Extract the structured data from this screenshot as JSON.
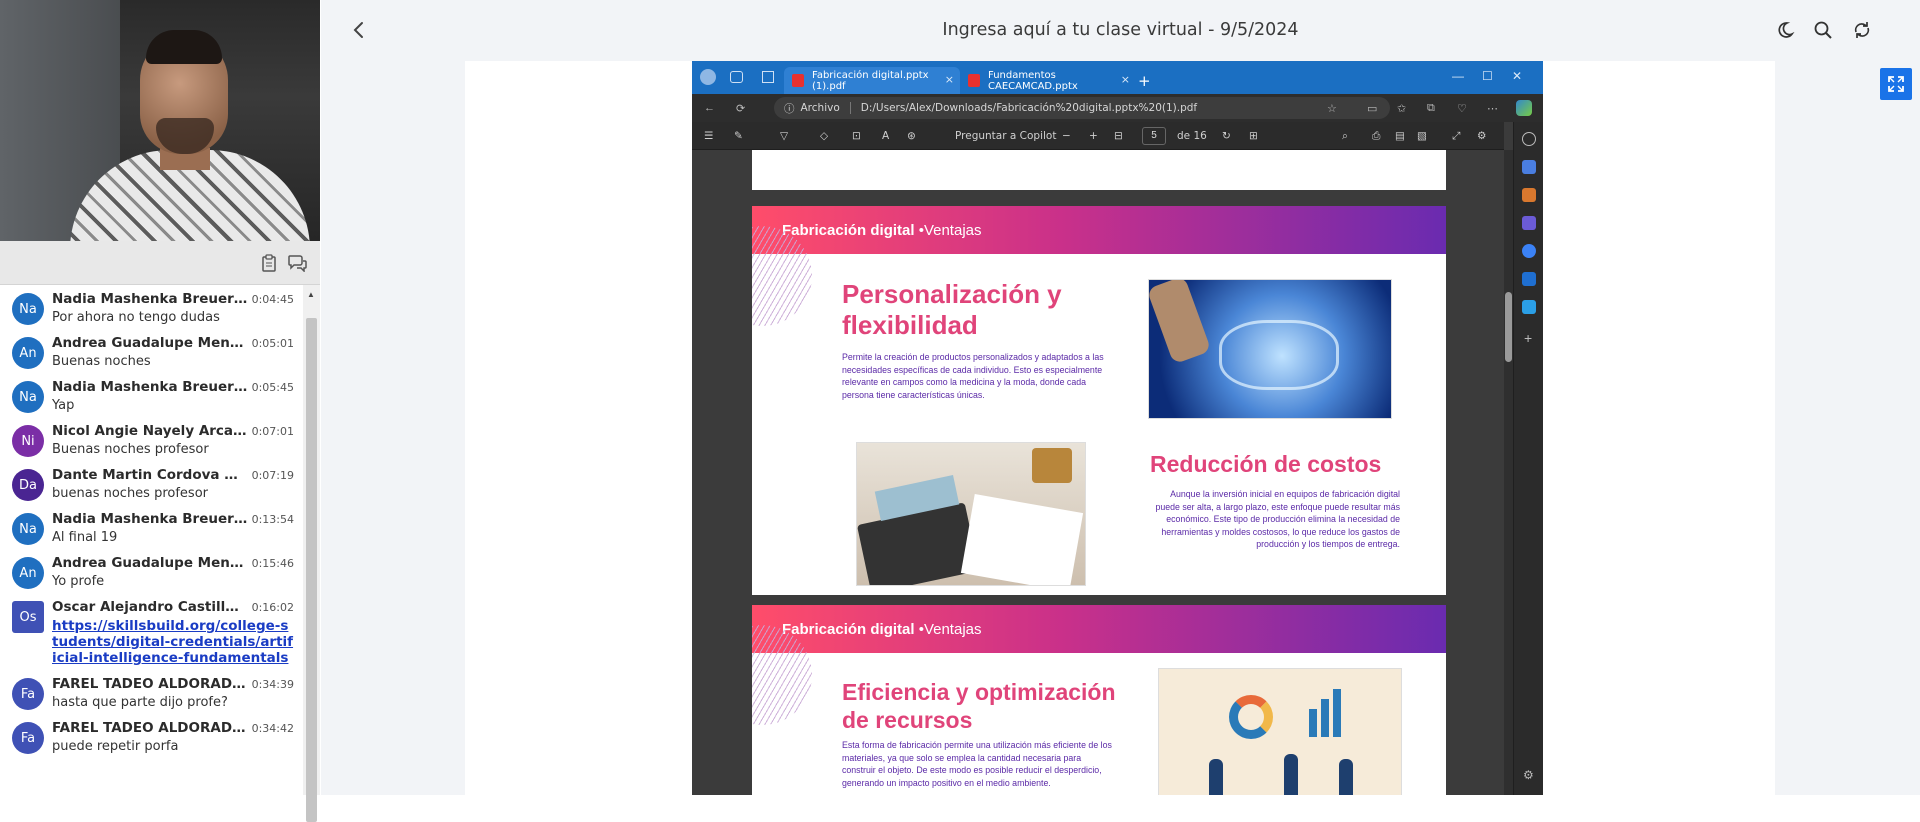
{
  "header": {
    "title": "Ingresa aquí a tu clase virtual - 9/5/2024",
    "back_icon": "chevron-left-icon",
    "icons": [
      "moon-icon",
      "search-icon",
      "sync-icon"
    ]
  },
  "chat": {
    "messages": [
      {
        "initials": "Na",
        "color": "#1f6fc0",
        "name": "Nadia Mashenka Breuer ...",
        "time": "0:04:45",
        "text": "Por ahora no tengo dudas"
      },
      {
        "initials": "An",
        "color": "#1f6fc0",
        "name": "Andrea Guadalupe Mena...",
        "time": "0:05:01",
        "text": "Buenas noches"
      },
      {
        "initials": "Na",
        "color": "#1f6fc0",
        "name": "Nadia Mashenka Breuer ...",
        "time": "0:05:45",
        "text": "Yap"
      },
      {
        "initials": "Ni",
        "color": "#7b2ea6",
        "name": "Nicol Angie Nayely Arcan...",
        "time": "0:07:01",
        "text": "Buenas noches profesor"
      },
      {
        "initials": "Da",
        "color": "#4a2592",
        "name": "Dante Martin Cordova M...",
        "time": "0:07:19",
        "text": "buenas noches profesor"
      },
      {
        "initials": "Na",
        "color": "#1f6fc0",
        "name": "Nadia Mashenka Breuer ...",
        "time": "0:13:54",
        "text": "Al final  19"
      },
      {
        "initials": "An",
        "color": "#1f6fc0",
        "name": "Andrea Guadalupe Mena...",
        "time": "0:15:46",
        "text": "Yo profe"
      },
      {
        "initials": "Os",
        "color": "#3f51b5",
        "name": "Oscar Alejandro Castillo ...",
        "time": "0:16:02",
        "link": "https://skillsbuild.org/college-students/digital-credentials/artificial-intelligence-fundamentals"
      },
      {
        "initials": "Fa",
        "color": "#3f51b5",
        "name": "FAREL TADEO ALDORADI...",
        "time": "0:34:39",
        "text": "hasta que parte dijo profe?"
      },
      {
        "initials": "Fa",
        "color": "#3f51b5",
        "name": "FAREL TADEO ALDORADI...",
        "time": "0:34:42",
        "text": "puede repetir porfa"
      }
    ]
  },
  "browser": {
    "tabs": [
      {
        "label": "Fabricación digital.pptx (1).pdf",
        "close": "×"
      },
      {
        "label": "Fundamentos CAECAMCAD.pptx",
        "close": "×"
      }
    ],
    "new_tab": "+",
    "address_label": "Archivo",
    "address": "D:/Users/Alex/Downloads/Fabricación%20digital.pptx%20(1).pdf",
    "pdf_toolbar": {
      "copilot": "Preguntar a Copilot",
      "minus": "−",
      "plus": "+",
      "page": "5",
      "of": "de 16"
    }
  },
  "slides": [
    {
      "banner_bold": "Fabricación digital",
      "banner_rest": " •Ventajas",
      "h1": "Personalización y flexibilidad",
      "p1": "Permite la creación de productos personalizados y adaptados a las necesidades específicas de cada individuo. Esto es especialmente relevante en campos como la medicina y la moda, donde cada persona tiene características únicas.",
      "h2": "Reducción de costos",
      "p2": "Aunque la inversión inicial en equipos de fabricación digital puede ser alta, a largo plazo, este enfoque puede resultar más económico. Este tipo de producción elimina la necesidad de herramientas y moldes costosos, lo que reduce los gastos de producción y los tiempos de entrega."
    },
    {
      "banner_bold": "Fabricación digital",
      "banner_rest": " •Ventajas",
      "h1": "Eficiencia y optimización de recursos",
      "p1": "Esta forma de fabricación permite una utilización más eficiente de los materiales, ya que solo se emplea la cantidad necesaria para construir el objeto. De este modo es posible reducir el desperdicio, generando un impacto positivo en el medio ambiente."
    }
  ]
}
